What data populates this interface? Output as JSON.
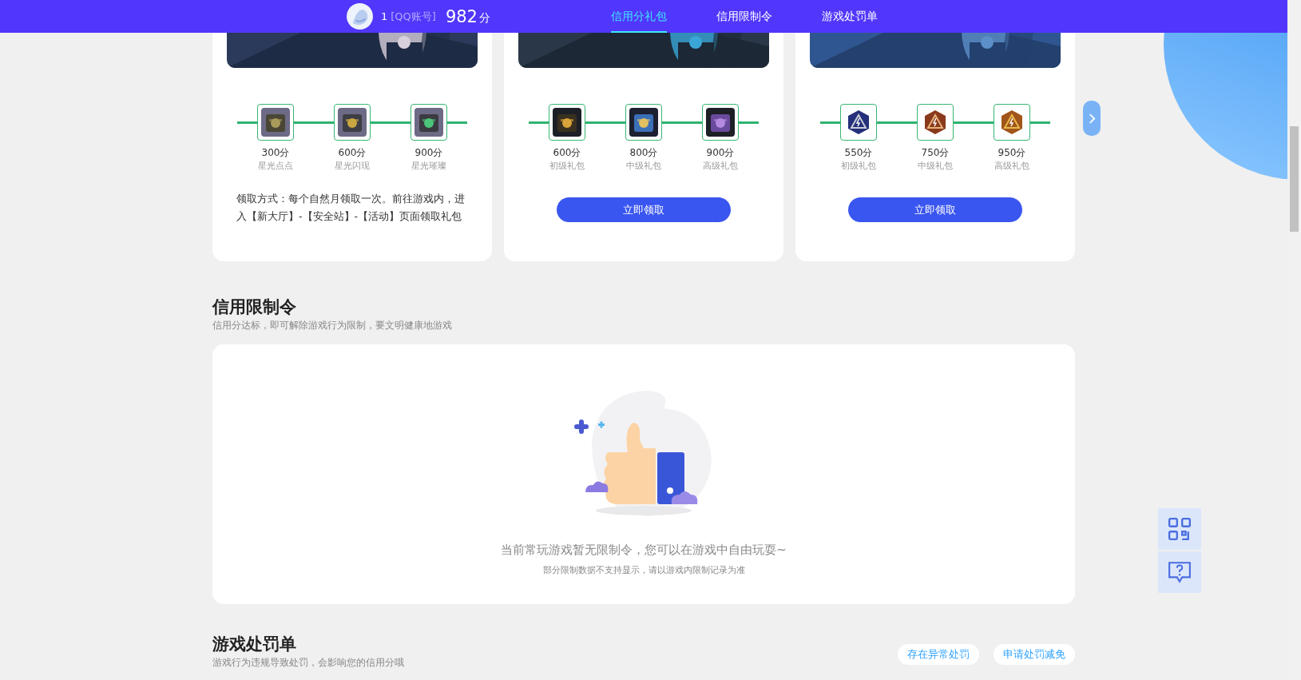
{
  "top_bar": {
    "account_id": "1",
    "account_type": "[QQ账号]",
    "score": "982",
    "score_unit": "分",
    "tabs": [
      {
        "label": "信用分礼包",
        "selected": true
      },
      {
        "label": "信用限制令",
        "selected": false
      },
      {
        "label": "游戏处罚单",
        "selected": false
      }
    ]
  },
  "gift_cards": [
    {
      "rewards": [
        {
          "points": "300分",
          "name": "星光点点"
        },
        {
          "points": "600分",
          "name": "星光闪现"
        },
        {
          "points": "900分",
          "name": "星光璀璨"
        }
      ],
      "footer": {
        "kind": "note",
        "text": "领取方式：每个自然月领取一次。前往游戏内，进入【新大厅】-【安全站】-【活动】页面领取礼包"
      }
    },
    {
      "rewards": [
        {
          "points": "600分",
          "name": "初级礼包"
        },
        {
          "points": "800分",
          "name": "中级礼包"
        },
        {
          "points": "900分",
          "name": "高级礼包"
        }
      ],
      "footer": {
        "kind": "button",
        "label": "立即领取"
      }
    },
    {
      "rewards": [
        {
          "points": "550分",
          "name": "初级礼包"
        },
        {
          "points": "750分",
          "name": "中级礼包"
        },
        {
          "points": "950分",
          "name": "高级礼包"
        }
      ],
      "footer": {
        "kind": "button",
        "label": "立即领取"
      }
    }
  ],
  "restriction_section": {
    "title": "信用限制令",
    "subtitle": "信用分达标，即可解除游戏行为限制，要文明健康地游戏",
    "empty_message": "当前常玩游戏暂无限制令，您可以在游戏中自由玩耍~",
    "empty_note": "部分限制数据不支持显示，请以游戏内限制记录为准"
  },
  "penalty_section": {
    "title": "游戏处罚单",
    "subtitle": "游戏行为违规导致处罚，会影响您的信用分哦",
    "buttons": [
      "存在异常处罚",
      "申请处罚减免"
    ]
  }
}
